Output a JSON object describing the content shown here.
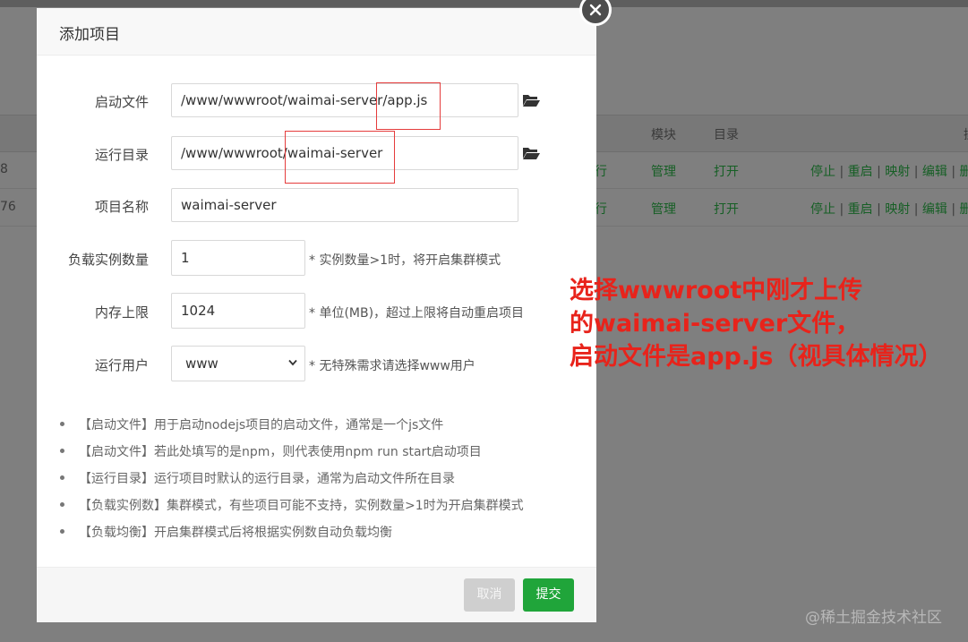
{
  "background_table": {
    "headers": {
      "module": "模块",
      "directory": "目录",
      "operations_partial": "操"
    },
    "rows": [
      {
        "id_partial": "8",
        "status_partial": "行",
        "module": "管理",
        "directory": "打开",
        "actions": [
          "停止",
          "重启",
          "映射",
          "编辑",
          "删"
        ]
      },
      {
        "id_partial": "76",
        "status_partial": "行",
        "module": "管理",
        "directory": "打开",
        "actions": [
          "停止",
          "重启",
          "映射",
          "编辑",
          "删"
        ]
      }
    ],
    "separator": "|",
    "link_color": "#165f25"
  },
  "modal": {
    "title": "添加项目",
    "close_icon": "close-icon",
    "fields": {
      "startup_file": {
        "label": "启动文件",
        "value": "/www/wwwroot/waimai-server/app.js",
        "icon": "folder-open-icon"
      },
      "run_dir": {
        "label": "运行目录",
        "value": "/www/wwwroot/waimai-server",
        "icon": "folder-open-icon"
      },
      "project_name": {
        "label": "项目名称",
        "value": "waimai-server"
      },
      "instances": {
        "label": "负载实例数量",
        "value": "1",
        "hint": "* 实例数量>1时，将开启集群模式"
      },
      "memory_limit": {
        "label": "内存上限",
        "value": "1024",
        "hint": "* 单位(MB)，超过上限将自动重启项目"
      },
      "run_user": {
        "label": "运行用户",
        "value": "www",
        "hint": "* 无特殊需求请选择www用户"
      }
    },
    "notes": [
      "【启动文件】用于启动nodejs项目的启动文件，通常是一个js文件",
      "【启动文件】若此处填写的是npm，则代表使用npm run start启动项目",
      "【运行目录】运行项目时默认的运行目录，通常为启动文件所在目录",
      "【负载实例数】集群模式，有些项目可能不支持，实例数量>1时为开启集群模式",
      "【负载均衡】开启集群模式后将根据实例数自动负载均衡"
    ],
    "buttons": {
      "cancel": "取消",
      "submit": "提交"
    },
    "accent_color": "#20a53a"
  },
  "annotation": {
    "lines": [
      "选择wwwroot中刚才上传",
      "的waimai-server文件，",
      "启动文件是app.js（视具体情况）"
    ],
    "color": "#e8231b"
  },
  "watermark": "@稀土掘金技术社区"
}
